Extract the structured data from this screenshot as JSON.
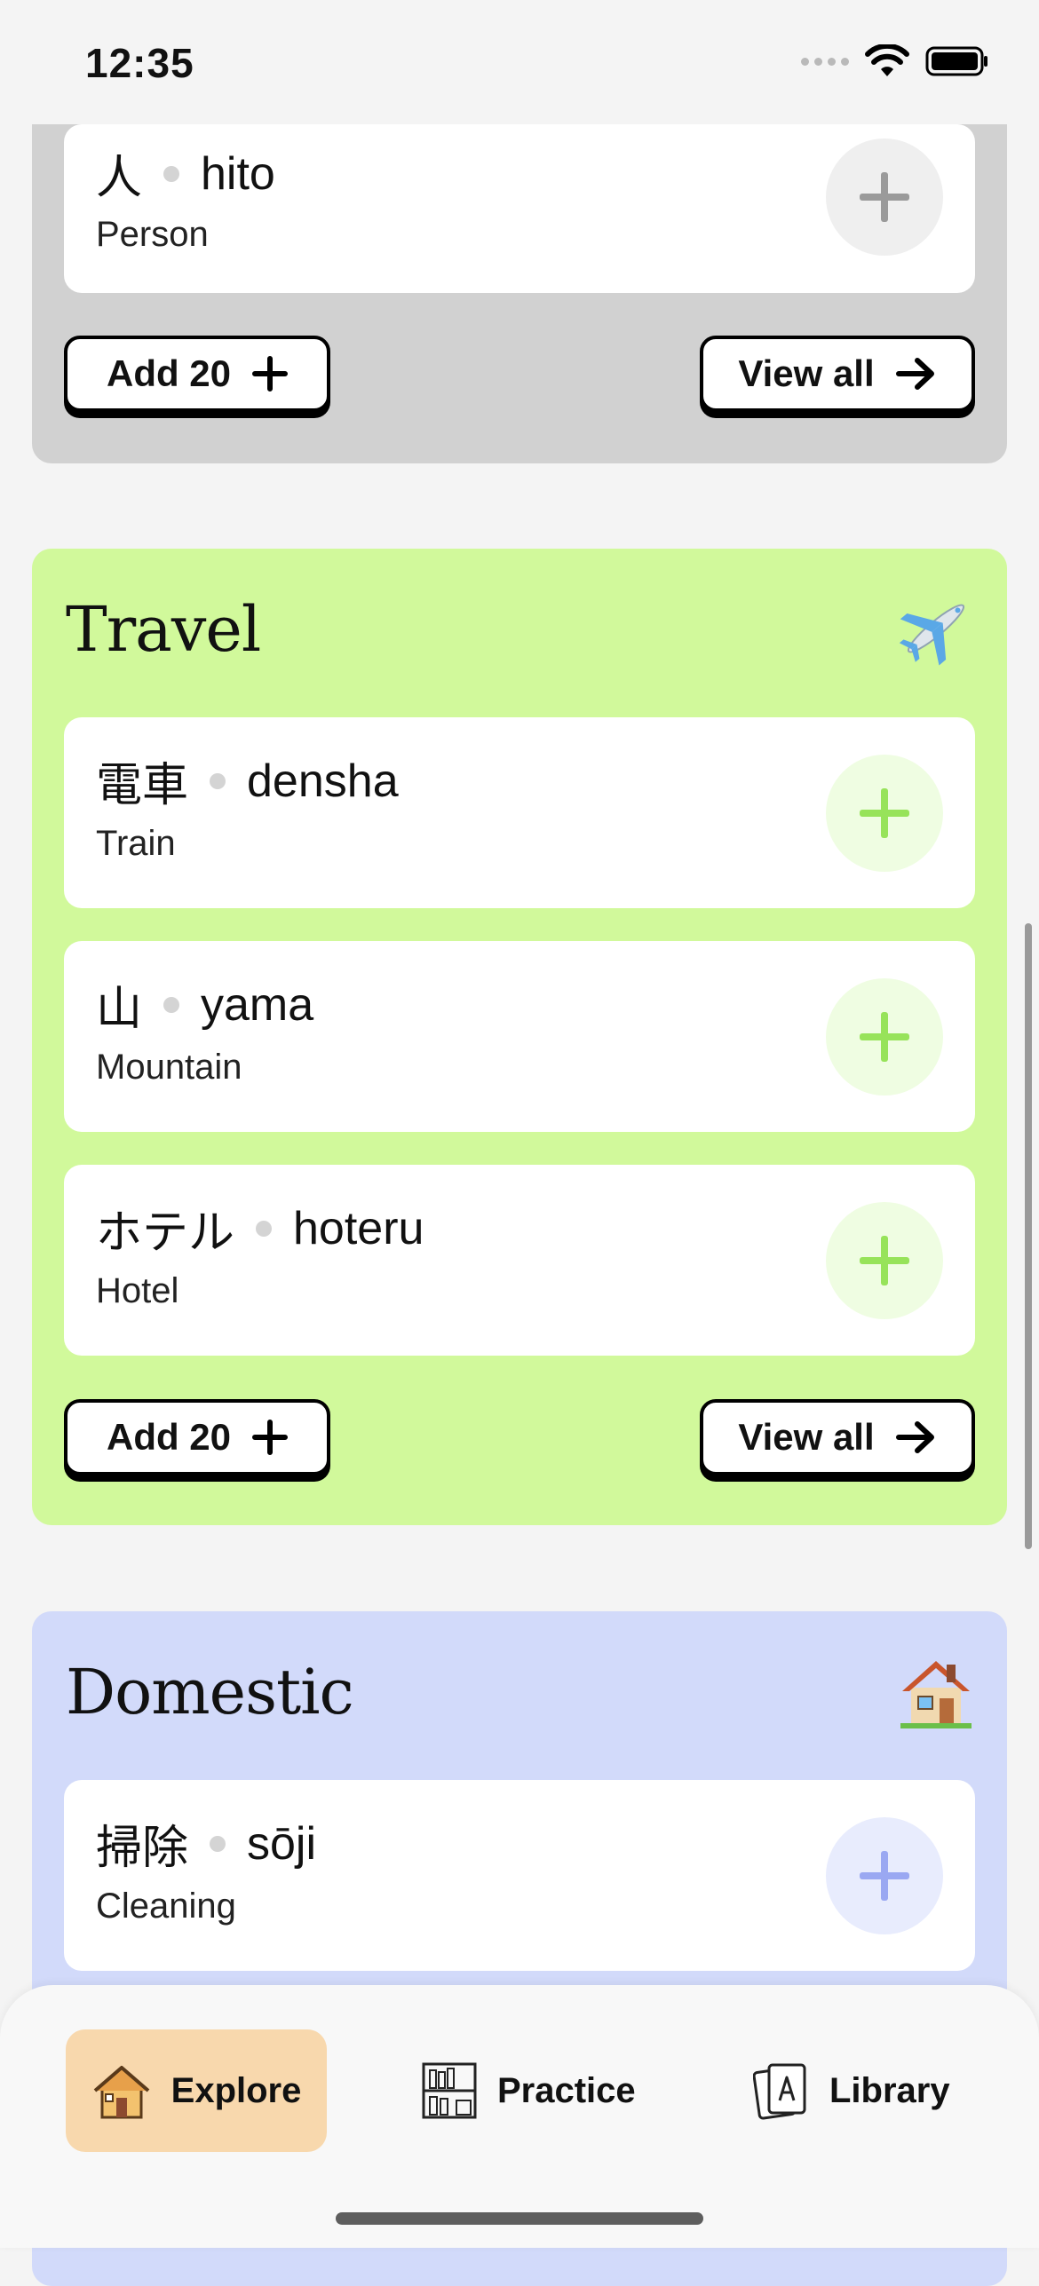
{
  "status": {
    "time": "12:35"
  },
  "sections": {
    "people": {
      "words": [
        {
          "kanji": "人",
          "romaji": "hito",
          "meaning": "Person"
        }
      ],
      "add_label": "Add 20",
      "view_label": "View all",
      "plus_color": "#9a9a9a",
      "circle_color": "#efefef"
    },
    "travel": {
      "title": "Travel",
      "icon": "airplane-icon",
      "words": [
        {
          "kanji": "電車",
          "romaji": "densha",
          "meaning": "Train"
        },
        {
          "kanji": "山",
          "romaji": "yama",
          "meaning": "Mountain"
        },
        {
          "kanji": "ホテル",
          "romaji": "hoteru",
          "meaning": "Hotel"
        }
      ],
      "add_label": "Add 20",
      "view_label": "View all",
      "plus_color": "#97e35a",
      "circle_color": "#effde2"
    },
    "domestic": {
      "title": "Domestic",
      "icon": "house-icon",
      "words": [
        {
          "kanji": "掃除",
          "romaji": "sōji",
          "meaning": "Cleaning"
        }
      ],
      "plus_color": "#9aa8f2",
      "circle_color": "#e8ecfd"
    }
  },
  "nav": {
    "explore": "Explore",
    "practice": "Practice",
    "library": "Library"
  }
}
